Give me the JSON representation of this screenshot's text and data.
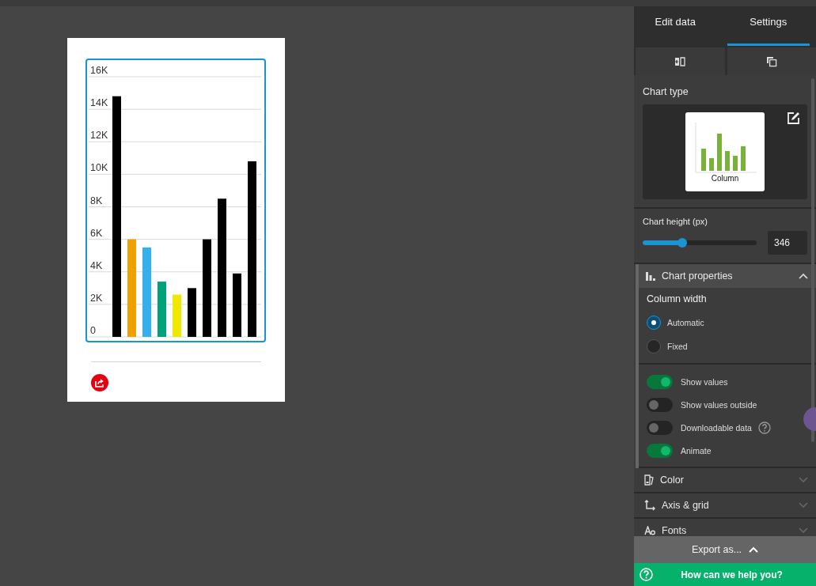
{
  "chart": {
    "chart_data": {
      "type": "bar",
      "ylim": [
        0,
        16000
      ],
      "yticks": [
        {
          "value": 0,
          "label": "0"
        },
        {
          "value": 2000,
          "label": "2K"
        },
        {
          "value": 4000,
          "label": "4K"
        },
        {
          "value": 6000,
          "label": "6K"
        },
        {
          "value": 8000,
          "label": "8K"
        },
        {
          "value": 10000,
          "label": "10K"
        },
        {
          "value": 12000,
          "label": "12K"
        },
        {
          "value": 14000,
          "label": "14K"
        },
        {
          "value": 16000,
          "label": "16K"
        }
      ],
      "grid": true,
      "values": [
        14800,
        6000,
        5500,
        3400,
        2600,
        3000,
        6000,
        8500,
        3900,
        10800
      ],
      "colors": [
        "#000000",
        "#f0a000",
        "#36b0ec",
        "#00a377",
        "#f0e800",
        "#000000",
        "#000000",
        "#000000",
        "#000000",
        "#000000"
      ]
    }
  },
  "tabs": [
    {
      "label": "Edit data",
      "selected": false
    },
    {
      "label": "Settings",
      "selected": true
    }
  ],
  "chart_type": {
    "label": "Chart type",
    "name": "Column"
  },
  "chart_height": {
    "label": "Chart height (px)",
    "level": 0.35,
    "value": "346"
  },
  "chart_properties": {
    "title": "Chart properties",
    "expanded": true,
    "column_width": {
      "label": "Column width",
      "options": [
        {
          "label": "Automatic",
          "selected": true
        },
        {
          "label": "Fixed",
          "selected": false
        }
      ]
    },
    "toggles": [
      {
        "label": "Show values",
        "on": true,
        "help": false
      },
      {
        "label": "Show values outside",
        "on": false,
        "help": false
      },
      {
        "label": "Downloadable data",
        "on": false,
        "help": true
      },
      {
        "label": "Animate",
        "on": true,
        "help": false
      }
    ]
  },
  "sections": [
    {
      "kind": "color",
      "title": "Color",
      "expanded": false
    },
    {
      "kind": "axis",
      "title": "Axis & grid",
      "expanded": false
    },
    {
      "kind": "fonts",
      "title": "Fonts",
      "expanded": false
    }
  ],
  "export_button": "Export as...",
  "help_button": "How can we help you?"
}
